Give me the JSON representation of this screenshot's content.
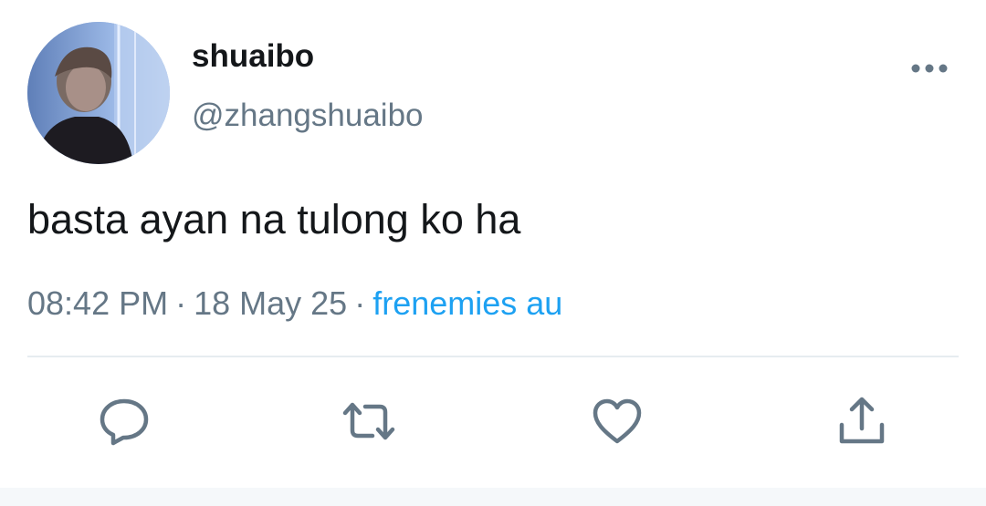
{
  "user": {
    "display_name": "shuaibo",
    "handle": "@zhangshuaibo",
    "avatar_icon": "profile-photo"
  },
  "tweet": {
    "text": "basta ayan na tulong ko ha"
  },
  "meta": {
    "time": "08:42 PM",
    "date": "18 May 25",
    "separator": "·",
    "source": "frenemies au"
  },
  "actions": {
    "reply_icon": "comment-bubble-icon",
    "retweet_icon": "retweet-arrows-icon",
    "like_icon": "heart-icon",
    "share_icon": "share-upload-icon"
  },
  "colors": {
    "text_primary": "#14171a",
    "text_secondary": "#657786",
    "link_blue": "#1da1f2",
    "divider": "#e6ecf0"
  }
}
